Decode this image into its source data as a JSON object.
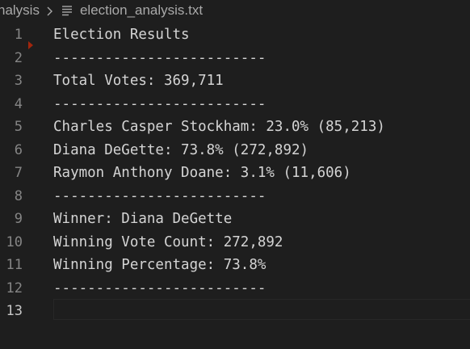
{
  "breadcrumb": {
    "folder": "nalysis",
    "separator_icon": "chevron-right-icon",
    "file_icon": "text-file-icon",
    "file": "election_analysis.txt"
  },
  "editor": {
    "lines": [
      {
        "number": "1",
        "text": "Election Results"
      },
      {
        "number": "2",
        "text": "-------------------------"
      },
      {
        "number": "3",
        "text": "Total Votes: 369,711"
      },
      {
        "number": "4",
        "text": "-------------------------"
      },
      {
        "number": "5",
        "text": "Charles Casper Stockham: 23.0% (85,213)"
      },
      {
        "number": "6",
        "text": "Diana DeGette: 73.8% (272,892)"
      },
      {
        "number": "7",
        "text": "Raymon Anthony Doane: 3.1% (11,606)"
      },
      {
        "number": "8",
        "text": "-------------------------"
      },
      {
        "number": "9",
        "text": "Winner: Diana DeGette"
      },
      {
        "number": "10",
        "text": "Winning Vote Count: 272,892"
      },
      {
        "number": "11",
        "text": "Winning Percentage: 73.8%"
      },
      {
        "number": "12",
        "text": "-------------------------"
      },
      {
        "number": "13",
        "text": ""
      }
    ],
    "active_line": "13"
  },
  "colors": {
    "background": "#1e1e1e",
    "text": "#d4d4d4",
    "line_number": "#858585",
    "active_line_number": "#c6c6c6",
    "fold_marker": "#a1260d"
  }
}
